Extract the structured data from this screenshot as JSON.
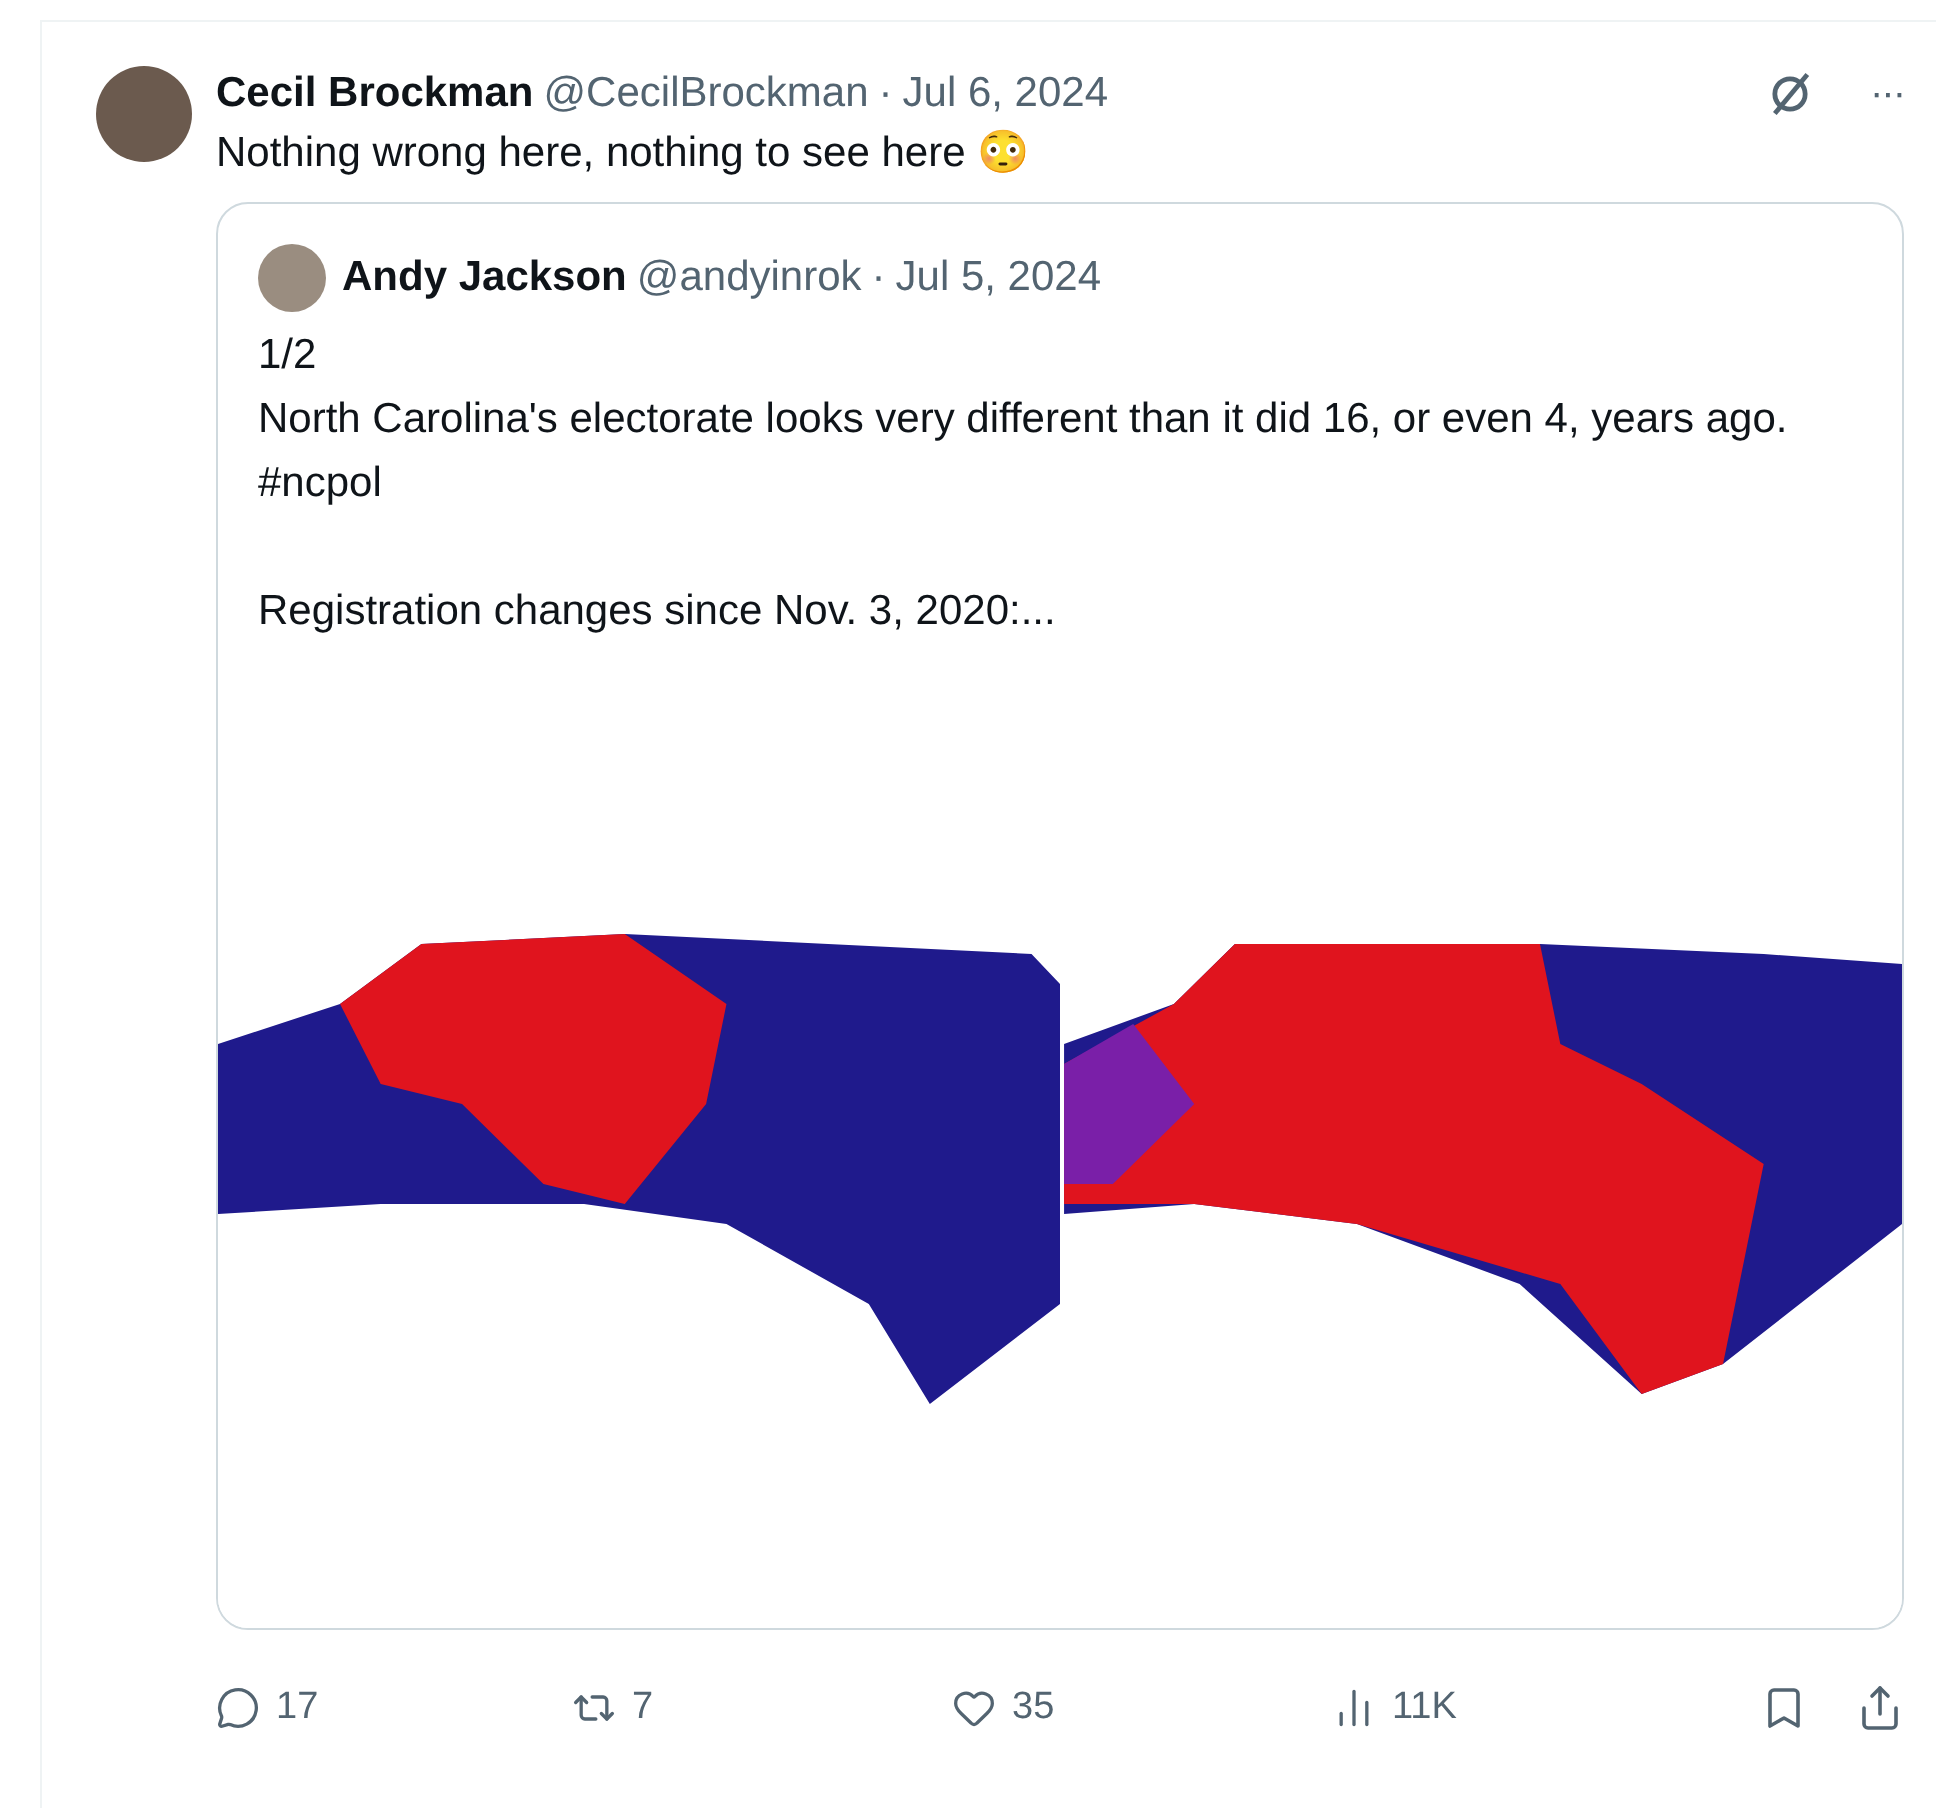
{
  "post": {
    "author": {
      "name": "Cecil Brockman",
      "handle": "@CecilBrockman",
      "date": "Jul 6, 2024"
    },
    "separator": "·",
    "more": "···",
    "text": "Nothing wrong here, nothing to see here 😳",
    "quote": {
      "author": {
        "name": "Andy Jackson",
        "handle": "@andyinrok",
        "date": "Jul 5, 2024"
      },
      "separator": "·",
      "paragraphs": [
        "1/2\nNorth Carolina's electorate looks very different than it did 16, or even 4, years ago. #ncpol",
        "Registration changes since Nov. 3, 2020:..."
      ]
    },
    "actions": [
      {
        "kind": "reply",
        "count": "17"
      },
      {
        "kind": "repost",
        "count": "7"
      },
      {
        "kind": "like",
        "count": "35"
      },
      {
        "kind": "views",
        "count": "11K"
      }
    ]
  }
}
